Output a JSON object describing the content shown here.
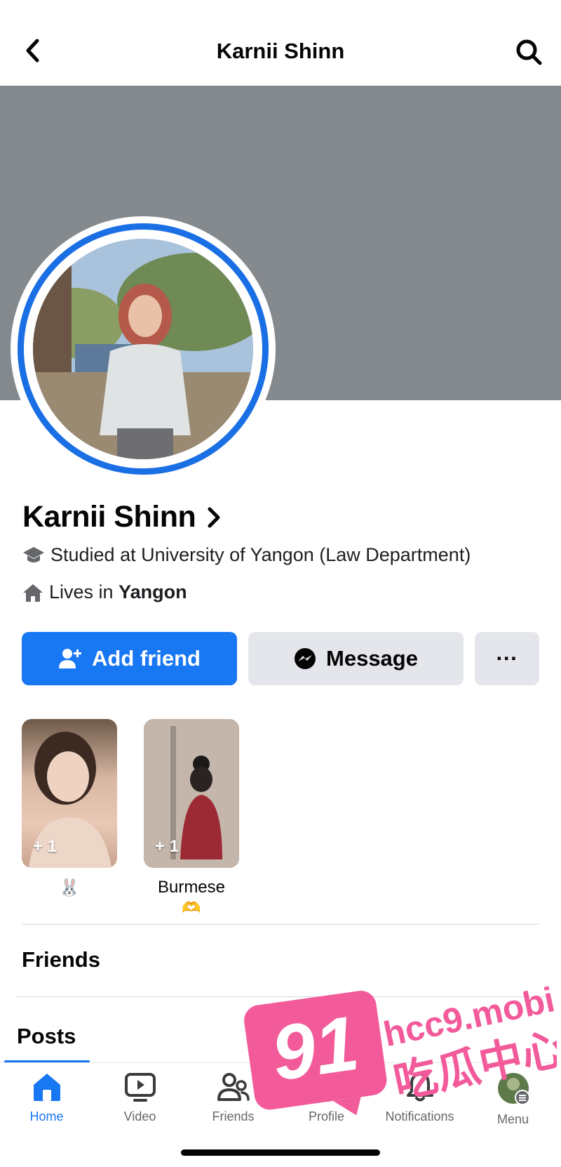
{
  "header": {
    "title": "Karnii Shinn",
    "back_icon": "chevron-left-icon",
    "search_icon": "search-icon"
  },
  "profile": {
    "name": "Karnii Shinn",
    "studied": "Studied at University of Yangon (Law Department)",
    "lives_prefix": "Lives in ",
    "lives_city": "Yangon"
  },
  "actions": {
    "add_friend": "Add friend",
    "message": "Message",
    "more": "···"
  },
  "highlights": [
    {
      "count": "+ 1",
      "label": "🐰",
      "sublabel": ""
    },
    {
      "count": "+ 1",
      "label": "Burmese",
      "sublabel": "🫶"
    }
  ],
  "sections": {
    "friends": "Friends",
    "posts": "Posts"
  },
  "nav": {
    "home": "Home",
    "video": "Video",
    "friends": "Friends",
    "profile": "Profile",
    "notifications": "Notifications",
    "menu": "Menu"
  },
  "watermark": {
    "number": "91",
    "site": "hcc9.mobi",
    "brand": "吃瓜中心"
  },
  "colors": {
    "accent": "#1877f2",
    "cover": "#84898d",
    "button_secondary": "#e4e6eb",
    "watermark": "#f25a9a"
  }
}
